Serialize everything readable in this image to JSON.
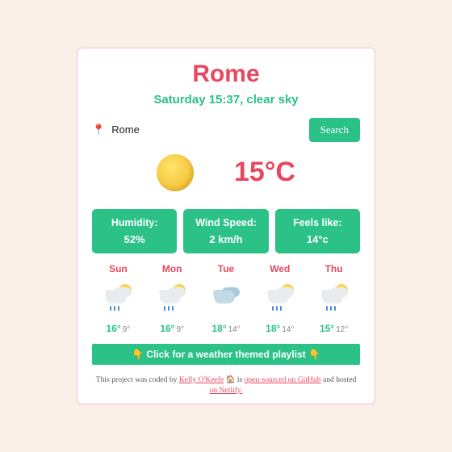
{
  "city": "Rome",
  "datetime_desc": "Saturday 15:37, clear sky",
  "search": {
    "placeholder": "",
    "value": "Rome",
    "button": "Search"
  },
  "current": {
    "temp": "15°C",
    "icon": "sun-icon"
  },
  "stats": {
    "humidity": {
      "label": "Humidity:",
      "value": "52%"
    },
    "wind": {
      "label": "Wind Speed:",
      "value": "2 km/h"
    },
    "feels": {
      "label": "Feels like:",
      "value": "14°c"
    }
  },
  "forecast": [
    {
      "day": "Sun",
      "icon": "sun-rain",
      "hi": "16°",
      "lo": "9°"
    },
    {
      "day": "Mon",
      "icon": "sun-rain",
      "hi": "16°",
      "lo": "9°"
    },
    {
      "day": "Tue",
      "icon": "cloudy",
      "hi": "18°",
      "lo": "14°"
    },
    {
      "day": "Wed",
      "icon": "sun-rain",
      "hi": "18°",
      "lo": "14°"
    },
    {
      "day": "Thu",
      "icon": "sun-rain",
      "hi": "15°",
      "lo": "12°"
    }
  ],
  "playlist": {
    "emoji": "👇",
    "text": "Click for a weather themed playlist"
  },
  "footer": {
    "pre": "This project was coded by ",
    "author": "Kelly O'Keefe",
    "mid1": " 🏠 is ",
    "link1": "open-sourced on GitHub",
    "mid2": " and hosted ",
    "link2": "on Netlify."
  }
}
